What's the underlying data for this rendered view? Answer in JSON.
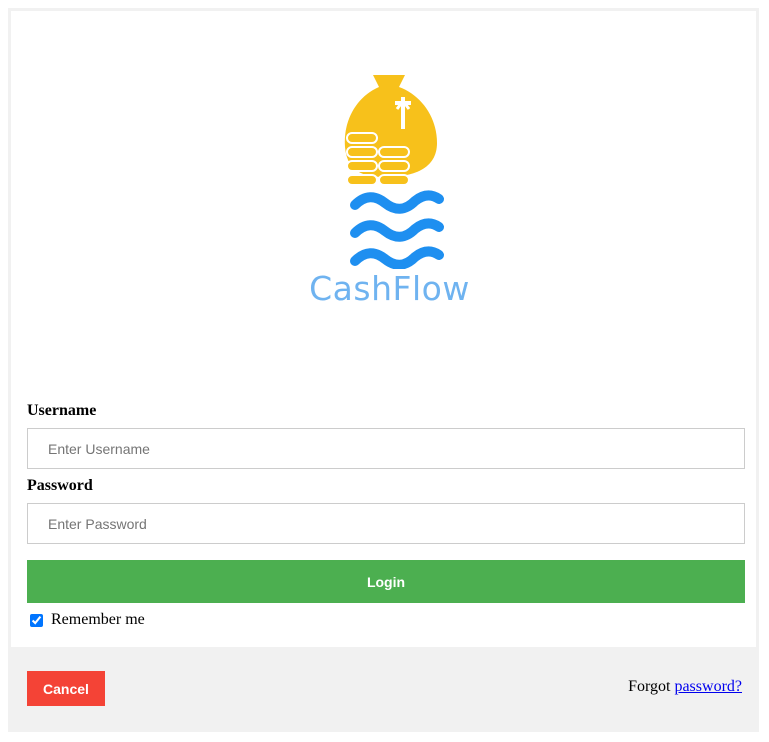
{
  "logo": {
    "text": "CashFlow",
    "icon": "money-bag-coins-waves-logo",
    "colors": {
      "bag": "#f7c11b",
      "waves": "#1e8ff0",
      "text": "#6fb3f0"
    }
  },
  "form": {
    "username_label": "Username",
    "username_placeholder": "Enter Username",
    "password_label": "Password",
    "password_placeholder": "Enter Password",
    "login_label": "Login",
    "remember_label": "Remember me",
    "remember_checked": true
  },
  "footer": {
    "cancel_label": "Cancel",
    "forgot_prefix": "Forgot",
    "forgot_link": "password?"
  },
  "colors": {
    "login": "#4caf50",
    "cancel": "#f44336",
    "footer_bg": "#f1f1f1"
  }
}
